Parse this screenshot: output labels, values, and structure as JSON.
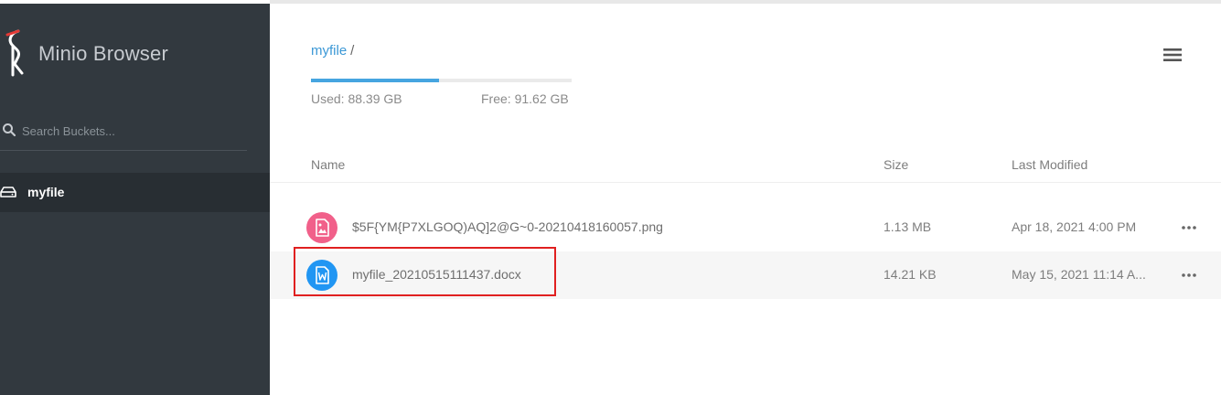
{
  "sidebar": {
    "brand": "Minio Browser",
    "search_placeholder": "Search Buckets...",
    "buckets": [
      {
        "name": "myfile",
        "active": true
      }
    ]
  },
  "main": {
    "breadcrumb": {
      "bucket": "myfile",
      "separator": "/"
    },
    "storage": {
      "used": "Used: 88.39 GB",
      "free": "Free: 91.62 GB",
      "used_fraction": 0.49
    },
    "columns": {
      "name": "Name",
      "size": "Size",
      "modified": "Last Modified"
    },
    "files": [
      {
        "name": "$5F{YM{P7XLGOQ)AQ]2@G~0-20210418160057.png",
        "size": "1.13 MB",
        "modified": "Apr 18, 2021 4:00 PM",
        "type": "image-icon",
        "color": "#f1608a"
      },
      {
        "name": "myfile_20210515111437.docx",
        "size": "14.21 KB",
        "modified": "May 15, 2021 11:14 A...",
        "type": "word-doc-icon",
        "color": "#2196f3"
      }
    ]
  },
  "colors": {
    "sidebar_bg": "#32393f",
    "active_bucket_bg": "#282e33",
    "accent": "#46a5e0",
    "highlight": "#e02020"
  }
}
